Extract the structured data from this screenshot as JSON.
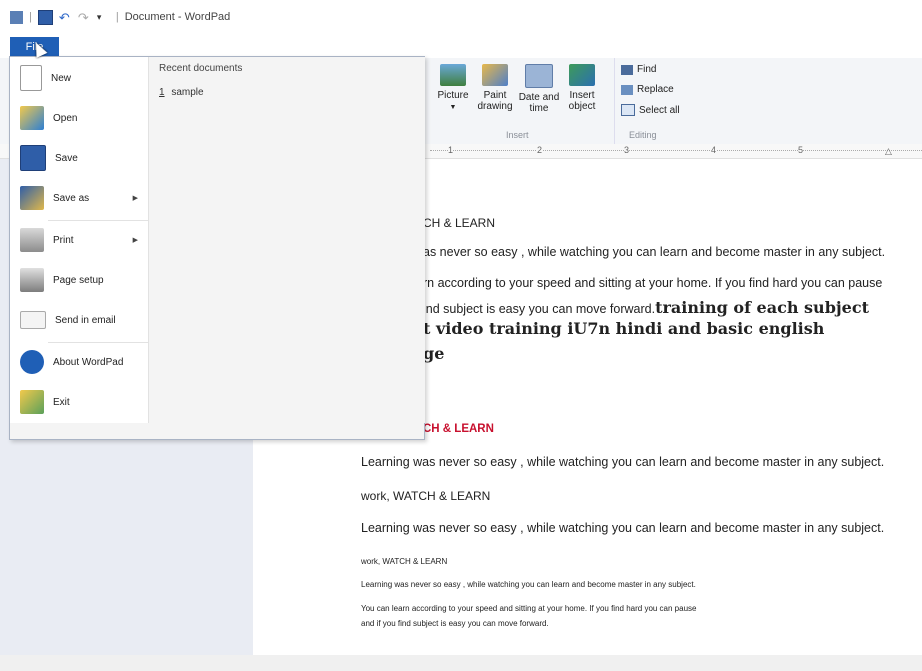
{
  "window": {
    "title": "Document - WordPad",
    "file_tab": "File"
  },
  "ribbon": {
    "insert": {
      "picture": "Picture",
      "paint_drawing": "Paint drawing",
      "date_time": "Date and time",
      "insert_object": "Insert object",
      "group_label": "Insert"
    },
    "editing": {
      "find": "Find",
      "replace": "Replace",
      "select_all": "Select all",
      "group_label": "Editing"
    }
  },
  "ruler": {
    "marks": [
      "1",
      "2",
      "3",
      "4",
      "5"
    ]
  },
  "file_menu": {
    "items": [
      {
        "label": "New",
        "icon": "new-document-icon"
      },
      {
        "label": "Open",
        "icon": "open-folder-icon"
      },
      {
        "label": "Save",
        "icon": "floppy-disk-icon"
      },
      {
        "label": "Save as",
        "icon": "save-as-icon"
      },
      {
        "label": "Print",
        "icon": "printer-icon"
      },
      {
        "label": "Page setup",
        "icon": "page-setup-icon"
      },
      {
        "label": "Send in email",
        "icon": "email-icon"
      },
      {
        "label": "About WordPad",
        "icon": "info-icon"
      },
      {
        "label": "Exit",
        "icon": "exit-icon"
      }
    ],
    "recent_title": "Recent documents",
    "recent_items": [
      {
        "index": "1",
        "name": "sample"
      }
    ]
  },
  "document": {
    "lines": [
      "CH & LEARN",
      "as never so easy , while watching you can learn and become master in any subject.",
      "rn according to your speed and sitting at your home. If you find hard you can pause",
      "ind subject is easy you can move forward.",
      "training of each subject",
      "t video training iU7n hindi and basic english",
      "ge",
      "CH & LEARN",
      "Learning was never so easy , while watching you can learn and become master in any subject.",
      "work, WATCH & LEARN",
      "Learning was never so easy , while watching you can learn and become master in any subject.",
      "work, WATCH & LEARN",
      "Learning was never so easy , while watching you can learn and become master in any subject.",
      "You can learn according to your speed and sitting at your home. If you find hard you can pause",
      "and if you find subject is easy you can move forward."
    ]
  },
  "colors": {
    "file_tab": "#1f5fb6",
    "red_heading": "#c8102e"
  }
}
